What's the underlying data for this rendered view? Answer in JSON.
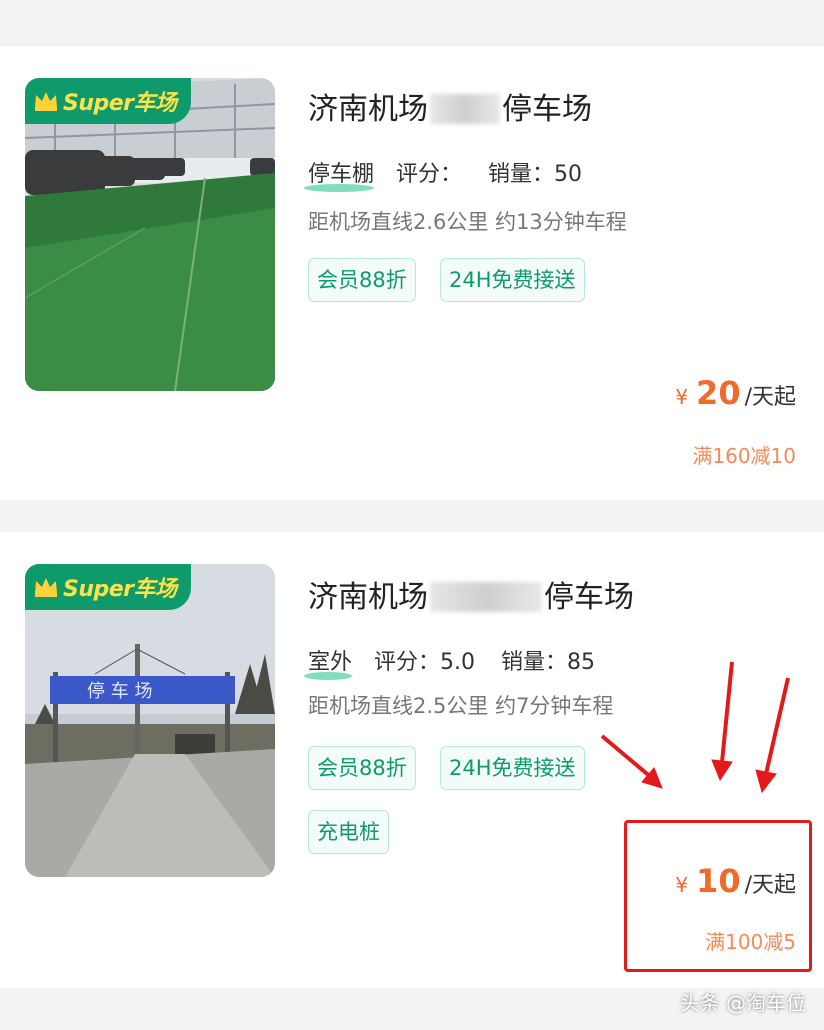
{
  "listings": [
    {
      "badge": "Super车场",
      "title_prefix": "济南机场",
      "title_suffix": "停车场",
      "type": "停车棚",
      "rating_label": "评分：",
      "rating_value": "",
      "sales": "销量：50",
      "distance": "距机场直线2.6公里 约13分钟车程",
      "tags": [
        "会员88折",
        "24H免费接送"
      ],
      "price_symbol": "¥",
      "price": "20",
      "price_unit": "/天起",
      "promo": "满160减10"
    },
    {
      "badge": "Super车场",
      "title_prefix": "济南机场",
      "title_suffix": "停车场",
      "type": "室外",
      "rating_label": "评分：",
      "rating_value": "5.0",
      "sales": "销量：85",
      "distance": "距机场直线2.5公里 约7分钟车程",
      "tags": [
        "会员88折",
        "24H免费接送",
        "充电桩"
      ],
      "price_symbol": "¥",
      "price": "10",
      "price_unit": "/天起",
      "promo": "满100减5",
      "gate_sign": "停 车 场"
    }
  ],
  "watermark": "头条 @淘车位",
  "colors": {
    "accent_green": "#0f9a6b",
    "price_orange": "#f06a2a",
    "highlight_red": "#e41a1a"
  }
}
